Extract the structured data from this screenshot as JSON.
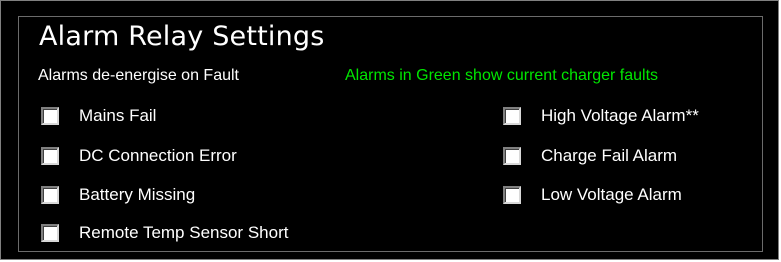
{
  "title": "Alarm Relay Settings",
  "subtitle": "Alarms de-energise on Fault",
  "fault_note": {
    "text": "Alarms in Green show current charger faults",
    "color": "#00e600"
  },
  "left_alarms": [
    {
      "label": "Mains Fail",
      "checked": false
    },
    {
      "label": "DC Connection Error",
      "checked": false
    },
    {
      "label": "Battery Missing",
      "checked": false
    },
    {
      "label": "Remote Temp Sensor Short",
      "checked": false
    }
  ],
  "right_alarms": [
    {
      "label": "High Voltage Alarm**",
      "checked": false
    },
    {
      "label": "Charge Fail Alarm",
      "checked": false
    },
    {
      "label": "Low Voltage Alarm",
      "checked": false
    }
  ]
}
